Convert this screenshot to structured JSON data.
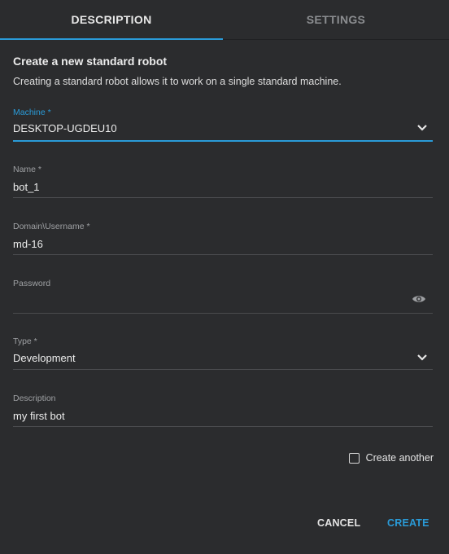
{
  "tabs": [
    {
      "label": "DESCRIPTION",
      "active": true
    },
    {
      "label": "SETTINGS",
      "active": false
    }
  ],
  "form": {
    "title": "Create a new standard robot",
    "subtitle": "Creating a standard robot allows it to work on a single standard machine.",
    "machine": {
      "label": "Machine *",
      "value": "DESKTOP-UGDEU10"
    },
    "name": {
      "label": "Name *",
      "value": "bot_1"
    },
    "username": {
      "label": "Domain\\Username *",
      "value": "md-16"
    },
    "password": {
      "label": "Password",
      "value": ""
    },
    "type": {
      "label": "Type *",
      "value": "Development"
    },
    "description": {
      "label": "Description",
      "value": "my first bot"
    },
    "create_another": {
      "label": "Create another",
      "checked": false
    }
  },
  "actions": {
    "cancel_label": "CANCEL",
    "create_label": "CREATE"
  },
  "icons": {
    "machine_dropdown": "chevron-down-icon",
    "type_dropdown": "chevron-down-icon",
    "password_toggle": "eye-icon"
  },
  "colors": {
    "accent": "#2a9bd8",
    "background": "#2b2c2e"
  }
}
